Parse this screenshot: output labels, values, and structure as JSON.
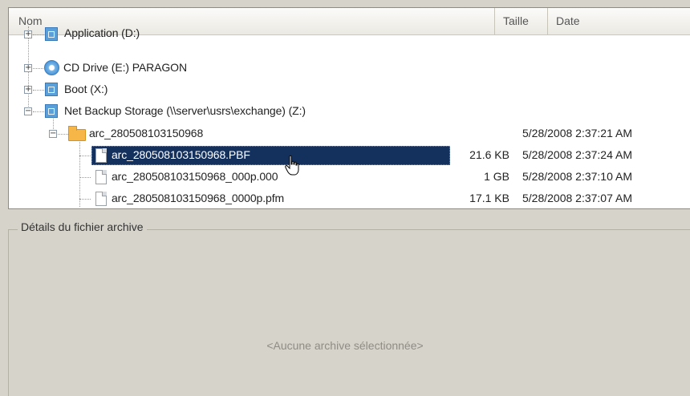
{
  "header": {
    "col_name": "Nom",
    "col_size": "Taille",
    "col_date": "Date"
  },
  "tree": [
    {
      "label": "Application (D:)",
      "icon": "drive-icon",
      "expander": "+"
    },
    {
      "label": "CD Drive (E:) PARAGON",
      "icon": "cd-icon",
      "expander": "+"
    },
    {
      "label": "Boot (X:)",
      "icon": "drive-icon",
      "expander": "+"
    },
    {
      "label": "Net Backup Storage (\\\\server\\usrs\\exchange) (Z:)",
      "icon": "drive-icon",
      "expander": "−"
    },
    {
      "label": "arc_280508103150968",
      "icon": "folder-icon",
      "expander": "−",
      "size": "",
      "date": "5/28/2008 2:37:21 AM"
    },
    {
      "label": "arc_280508103150968.PBF",
      "icon": "file-icon",
      "size": "21.6 KB",
      "date": "5/28/2008 2:37:24 AM",
      "selected": true
    },
    {
      "label": "arc_280508103150968_000p.000",
      "icon": "file-icon",
      "size": "1 GB",
      "date": "5/28/2008 2:37:10 AM"
    },
    {
      "label": "arc_280508103150968_0000p.pfm",
      "icon": "file-icon",
      "size": "17.1 KB",
      "date": "5/28/2008 2:37:07 AM"
    }
  ],
  "details": {
    "legend": "Détails du fichier archive",
    "placeholder": "<Aucune archive sélectionnée>"
  },
  "colors": {
    "selection": "#14315e",
    "panel_bg": "#d6d3cb"
  }
}
